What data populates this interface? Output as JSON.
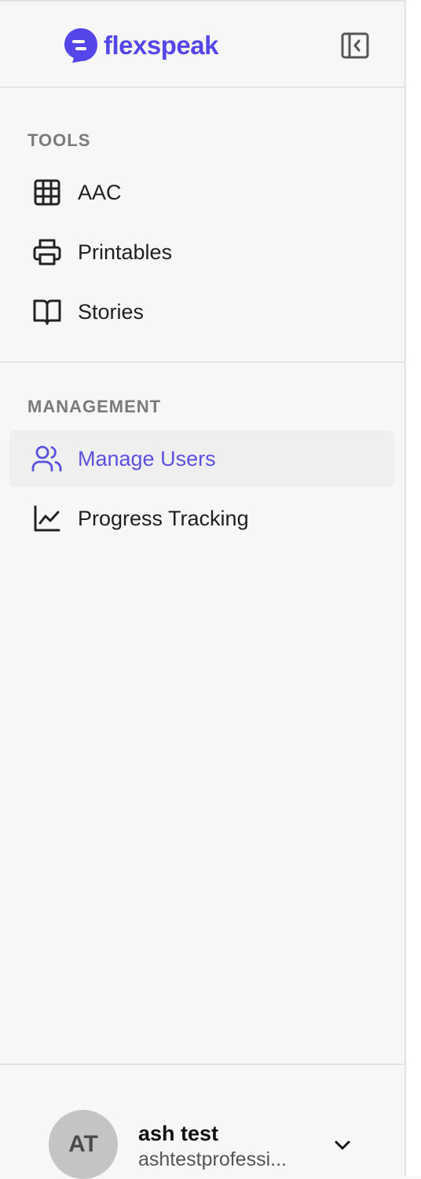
{
  "brand": {
    "name": "flexspeak",
    "color": "#5446e8"
  },
  "header": {
    "collapse_icon": "sidebar-collapse-icon"
  },
  "sections": {
    "tools": {
      "title": "TOOLS",
      "items": [
        {
          "label": "AAC",
          "icon": "grid-icon"
        },
        {
          "label": "Printables",
          "icon": "printer-icon"
        },
        {
          "label": "Stories",
          "icon": "book-open-icon"
        }
      ]
    },
    "management": {
      "title": "MANAGEMENT",
      "items": [
        {
          "label": "Manage Users",
          "icon": "users-icon",
          "active": true
        },
        {
          "label": "Progress Tracking",
          "icon": "chart-line-icon"
        }
      ]
    }
  },
  "user": {
    "initials": "AT",
    "name": "ash test",
    "email": "ashtestprofessi...",
    "menu_icon": "chevron-down-icon"
  },
  "colors": {
    "accent": "#5b50e0",
    "active_bg": "#efefef",
    "background": "#f7f7f7"
  }
}
